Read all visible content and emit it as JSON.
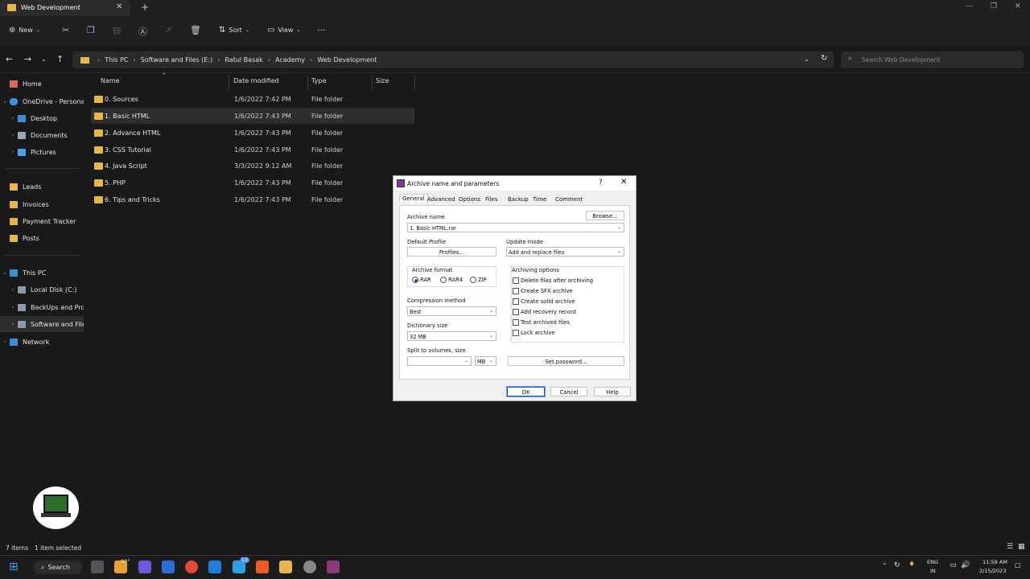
{
  "window": {
    "tab_title": "Web Development"
  },
  "toolbar": {
    "new": "New",
    "sort": "Sort",
    "view": "View",
    "more": "···"
  },
  "address": {
    "crumbs": [
      "This PC",
      "Software and Files (E:)",
      "Ratul Basak",
      "Academy",
      "Web Development"
    ],
    "search_placeholder": "Search Web Development"
  },
  "sidebar": {
    "home": "Home",
    "onedrive": "OneDrive - Persona",
    "desktop": "Desktop",
    "documents": "Documents",
    "pictures": "Pictures",
    "leads": "Leads",
    "invoices": "Invoices",
    "payment": "Payment Tracker",
    "posts": "Posts",
    "thispc": "This PC",
    "localc": "Local Disk (C:)",
    "backups": "BackUps and Proj",
    "software": "Software and Files",
    "network": "Network"
  },
  "columns": {
    "name": "Name",
    "date": "Date modified",
    "type": "Type",
    "size": "Size"
  },
  "files": [
    {
      "name": "0. Sources",
      "date": "1/6/2022 7:42 PM",
      "type": "File folder"
    },
    {
      "name": "1. Basic HTML",
      "date": "1/6/2022 7:43 PM",
      "type": "File folder"
    },
    {
      "name": "2. Advance HTML",
      "date": "1/6/2022 7:43 PM",
      "type": "File folder"
    },
    {
      "name": "3. CSS Tutorial",
      "date": "1/6/2022 7:43 PM",
      "type": "File folder"
    },
    {
      "name": "4. Java Script",
      "date": "3/3/2022 9:12 AM",
      "type": "File folder"
    },
    {
      "name": "5. PHP",
      "date": "1/6/2022 7:43 PM",
      "type": "File folder"
    },
    {
      "name": "6. Tips and Tricks",
      "date": "1/6/2022 7:43 PM",
      "type": "File folder"
    }
  ],
  "status": {
    "items": "7 items",
    "selected": "1 item selected"
  },
  "dialog": {
    "title": "Archive name and parameters",
    "tabs": [
      "General",
      "Advanced",
      "Options",
      "Files",
      "Backup",
      "Time",
      "Comment"
    ],
    "archive_name_label": "Archive name",
    "browse": "Browse...",
    "archive_name": "1. Basic HTML.rar",
    "default_profile": "Default Profile",
    "profiles": "Profiles...",
    "update_mode_label": "Update mode",
    "update_mode": "Add and replace files",
    "archive_format": "Archive format",
    "formats": [
      "RAR",
      "RAR4",
      "ZIP"
    ],
    "compression_label": "Compression method",
    "compression": "Best",
    "dict_label": "Dictionary size",
    "dict": "32 MB",
    "split_label": "Split to volumes, size",
    "split_unit": "MB",
    "options_label": "Archiving options",
    "options": [
      "Delete files after archiving",
      "Create SFX archive",
      "Create solid archive",
      "Add recovery record",
      "Test archived files",
      "Lock archive"
    ],
    "set_password": "Set password...",
    "ok": "OK",
    "cancel": "Cancel",
    "help": "Help"
  },
  "taskbar": {
    "search": "Search",
    "weather": "80°",
    "badge": "13",
    "lang": "ENG",
    "region": "IN",
    "time": "11:59 AM",
    "date": "2/15/2023"
  }
}
